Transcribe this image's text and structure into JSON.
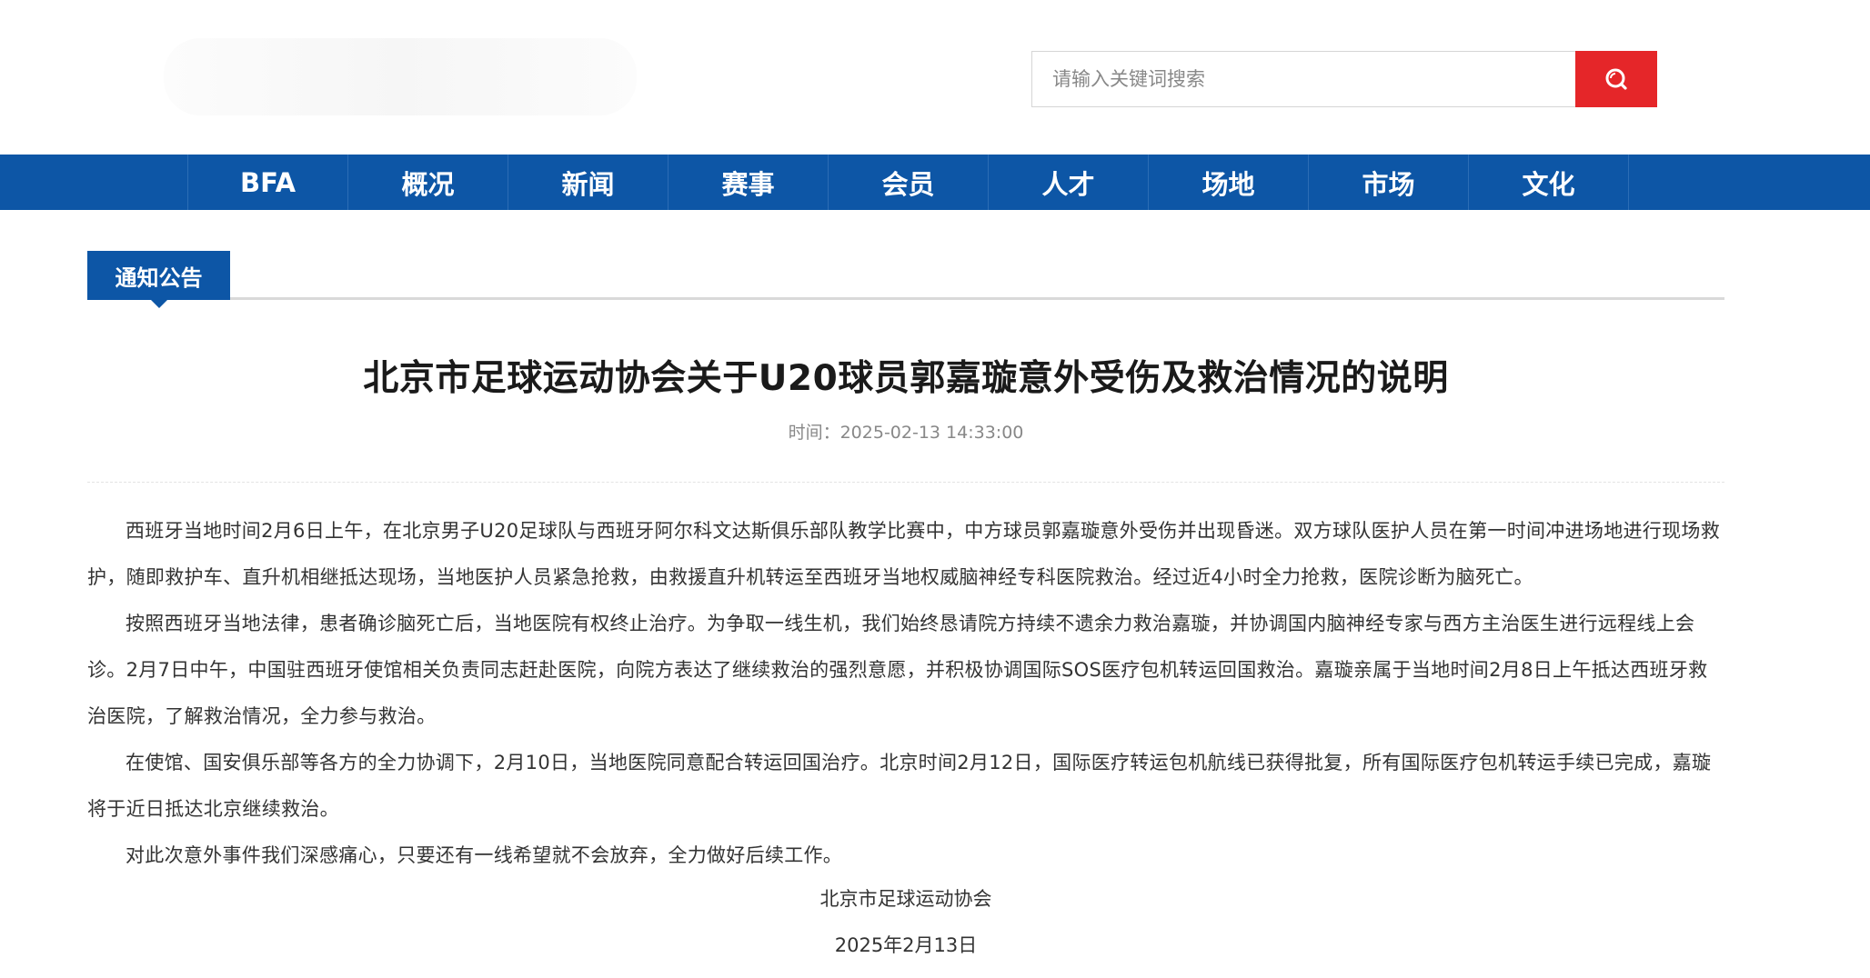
{
  "search": {
    "placeholder": "请输入关键词搜索"
  },
  "nav": {
    "items": [
      "BFA",
      "概况",
      "新闻",
      "赛事",
      "会员",
      "人才",
      "场地",
      "市场",
      "文化"
    ]
  },
  "section": {
    "label": "通知公告"
  },
  "article": {
    "title": "北京市足球运动协会关于U20球员郭嘉璇意外受伤及救治情况的说明",
    "meta": "时间：2025-02-13 14:33:00",
    "paragraphs": [
      "西班牙当地时间2月6日上午，在北京男子U20足球队与西班牙阿尔科文达斯俱乐部队教学比赛中，中方球员郭嘉璇意外受伤并出现昏迷。双方球队医护人员在第一时间冲进场地进行现场救护，随即救护车、直升机相继抵达现场，当地医护人员紧急抢救，由救援直升机转运至西班牙当地权威脑神经专科医院救治。经过近4小时全力抢救，医院诊断为脑死亡。",
      "按照西班牙当地法律，患者确诊脑死亡后，当地医院有权终止治疗。为争取一线生机，我们始终恳请院方持续不遗余力救治嘉璇，并协调国内脑神经专家与西方主治医生进行远程线上会诊。2月7日中午，中国驻西班牙使馆相关负责同志赶赴医院，向院方表达了继续救治的强烈意愿，并积极协调国际SOS医疗包机转运回国救治。嘉璇亲属于当地时间2月8日上午抵达西班牙救治医院，了解救治情况，全力参与救治。",
      "在使馆、国安俱乐部等各方的全力协调下，2月10日，当地医院同意配合转运回国治疗。北京时间2月12日，国际医疗转运包机航线已获得批复，所有国际医疗包机转运手续已完成，嘉璇将于近日抵达北京继续救治。",
      "对此次意外事件我们深感痛心，只要还有一线希望就不会放弃，全力做好后续工作。"
    ],
    "signature": "北京市足球运动协会",
    "date": "2025年2月13日"
  },
  "colors": {
    "nav_bg": "#0d56a6",
    "search_button": "#e52629"
  },
  "icons": {
    "search_button": "search-icon"
  }
}
